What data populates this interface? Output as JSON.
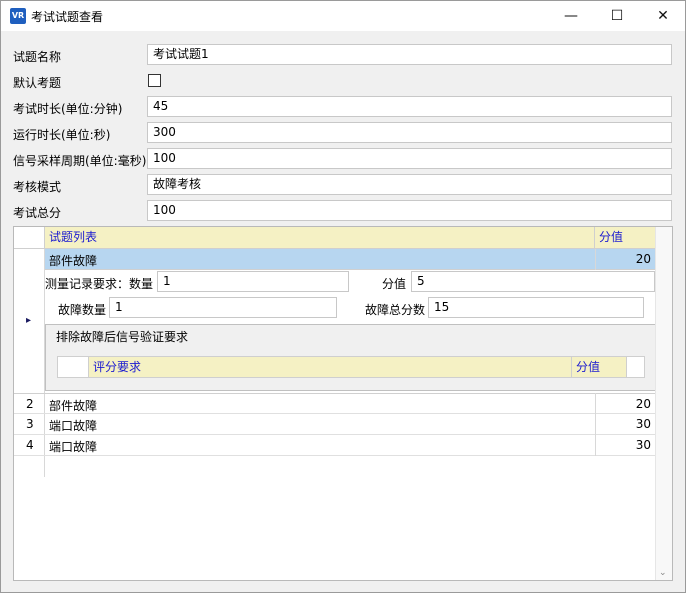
{
  "window": {
    "title": "考试试题查看",
    "app_icon_text": "VR",
    "minimize_glyph": "—",
    "maximize_glyph": "☐",
    "close_glyph": "✕"
  },
  "form": {
    "name_label": "试题名称",
    "name_value": "考试试题1",
    "default_label": "默认考题",
    "default_checked": false,
    "duration_label": "考试时长(单位:分钟)",
    "duration_value": "45",
    "run_label": "运行时长(单位:秒)",
    "run_value": "300",
    "sample_label": "信号采样周期(单位:毫秒)",
    "sample_value": "100",
    "mode_label": "考核模式",
    "mode_value": "故障考核",
    "total_label": "考试总分",
    "total_value": "100"
  },
  "grid": {
    "col_list": "试题列表",
    "col_score": "分值",
    "selected": {
      "name": "部件故障",
      "score": "20",
      "measure_label": "测量记录要求：数量",
      "measure_count": "1",
      "measure_score_label": "分值",
      "measure_score": "5",
      "fault_count_label": "故障数量",
      "fault_count": "1",
      "fault_total_label": "故障总分数",
      "fault_total": "15",
      "verify_title": "排除故障后信号验证要求",
      "inner_col_req": "评分要求",
      "inner_col_score": "分值",
      "row_marker": "▸"
    },
    "rows": [
      {
        "num": "2",
        "name": "部件故障",
        "score": "20"
      },
      {
        "num": "3",
        "name": "端口故障",
        "score": "30"
      },
      {
        "num": "4",
        "name": "端口故障",
        "score": "30"
      }
    ],
    "scroll_glyph": "⌄"
  }
}
